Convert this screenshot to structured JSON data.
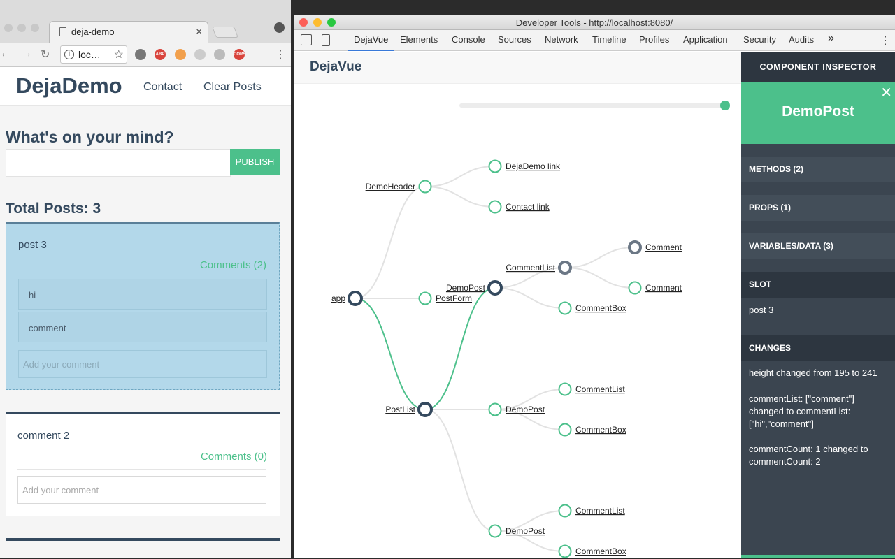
{
  "browser": {
    "tab_title": "deja-demo",
    "tab_close": "×",
    "url": "loc…",
    "info_glyph": "i",
    "star_glyph": "☆",
    "back_glyph": "←",
    "forward_glyph": "→",
    "reload_glyph": "↻",
    "menu_glyph": "⋮",
    "extensions": [
      {
        "name": "cast",
        "color": "#777777",
        "label": ""
      },
      {
        "name": "abp",
        "color": "#d9443c",
        "label": "ABP"
      },
      {
        "name": "pencil",
        "color": "#f2a04c",
        "label": ""
      },
      {
        "name": "gear",
        "color": "#cccccc",
        "label": ""
      },
      {
        "name": "code",
        "color": "#bbbbbb",
        "label": ""
      },
      {
        "name": "cors",
        "color": "#d9443c",
        "label": "CORS"
      }
    ]
  },
  "site": {
    "brand": "DejaDemo",
    "nav": [
      "Contact",
      "Clear Posts"
    ],
    "prompt_heading": "What's on your mind?",
    "post_input_value": "",
    "publish_label": "PUBLISH",
    "total_heading": "Total Posts: 3",
    "posts": [
      {
        "title": "post 3",
        "comments_label": "Comments (2)",
        "comments": [
          "hi",
          "comment"
        ],
        "comment_placeholder": "Add your comment"
      },
      {
        "title": "comment 2",
        "comments_label": "Comments (0)",
        "comments": [],
        "comment_placeholder": "Add your comment"
      }
    ]
  },
  "devtools": {
    "window_title": "Developer Tools - http://localhost:8080/",
    "tabs": [
      "DejaVue",
      "Elements",
      "Console",
      "Sources",
      "Network",
      "Timeline",
      "Profiles",
      "Application",
      "Security",
      "Audits"
    ],
    "active_tab": "DejaVue",
    "more_glyph": "»",
    "kebab_glyph": "⋮"
  },
  "dejavue": {
    "logo": "DejaVue",
    "timeline_position": 1.0,
    "tree": {
      "nodes": [
        {
          "id": "app",
          "label": "app",
          "state": "dark"
        },
        {
          "id": "demoheader",
          "label": "DemoHeader",
          "state": "green"
        },
        {
          "id": "postform",
          "label": "PostForm",
          "state": "green"
        },
        {
          "id": "postlist",
          "label": "PostList",
          "state": "dark"
        },
        {
          "id": "link1",
          "label": "DejaDemo link",
          "state": "green"
        },
        {
          "id": "link2",
          "label": "Contact link",
          "state": "green"
        },
        {
          "id": "post1",
          "label": "DemoPost",
          "state": "dark"
        },
        {
          "id": "post2",
          "label": "DemoPost",
          "state": "green"
        },
        {
          "id": "post3",
          "label": "DemoPost",
          "state": "green"
        },
        {
          "id": "clist1",
          "label": "CommentList",
          "state": "gray"
        },
        {
          "id": "cbox1",
          "label": "CommentBox",
          "state": "green"
        },
        {
          "id": "comment1",
          "label": "Comment",
          "state": "gray"
        },
        {
          "id": "comment2",
          "label": "Comment",
          "state": "green"
        },
        {
          "id": "clist2",
          "label": "CommentList",
          "state": "green"
        },
        {
          "id": "cbox2",
          "label": "CommentBox",
          "state": "green"
        },
        {
          "id": "clist3",
          "label": "CommentList",
          "state": "green"
        },
        {
          "id": "cbox3",
          "label": "CommentBox",
          "state": "green"
        }
      ],
      "links": [
        [
          "app",
          "demoheader",
          false
        ],
        [
          "app",
          "postform",
          false
        ],
        [
          "app",
          "postlist",
          true
        ],
        [
          "demoheader",
          "link1",
          false
        ],
        [
          "demoheader",
          "link2",
          false
        ],
        [
          "postlist",
          "post1",
          true
        ],
        [
          "postlist",
          "post2",
          false
        ],
        [
          "postlist",
          "post3",
          false
        ],
        [
          "post1",
          "clist1",
          false
        ],
        [
          "post1",
          "cbox1",
          false
        ],
        [
          "clist1",
          "comment1",
          false
        ],
        [
          "clist1",
          "comment2",
          false
        ],
        [
          "post2",
          "clist2",
          false
        ],
        [
          "post2",
          "cbox2",
          false
        ],
        [
          "post3",
          "clist3",
          false
        ],
        [
          "post3",
          "cbox3",
          false
        ]
      ]
    }
  },
  "inspector": {
    "heading": "COMPONENT INSPECTOR",
    "component": "DemoPost",
    "close_glyph": "✕",
    "methods": "METHODS (2)",
    "props": "PROPS (1)",
    "variables": "VARIABLES/DATA (3)",
    "slot_heading": "SLOT",
    "slot_value": "post 3",
    "changes_heading": "CHANGES",
    "changes": [
      "height changed from 195 to 241",
      "commentList: [\"comment\"] changed to commentList: [\"hi\",\"comment\"]",
      "commentCount: 1 changed to commentCount: 2"
    ]
  },
  "colors": {
    "accent_green": "#4cc08b",
    "navy": "#34495e",
    "node_dark": "#34495e",
    "node_gray": "#6b7785",
    "link_gray": "#e2e2e2"
  }
}
